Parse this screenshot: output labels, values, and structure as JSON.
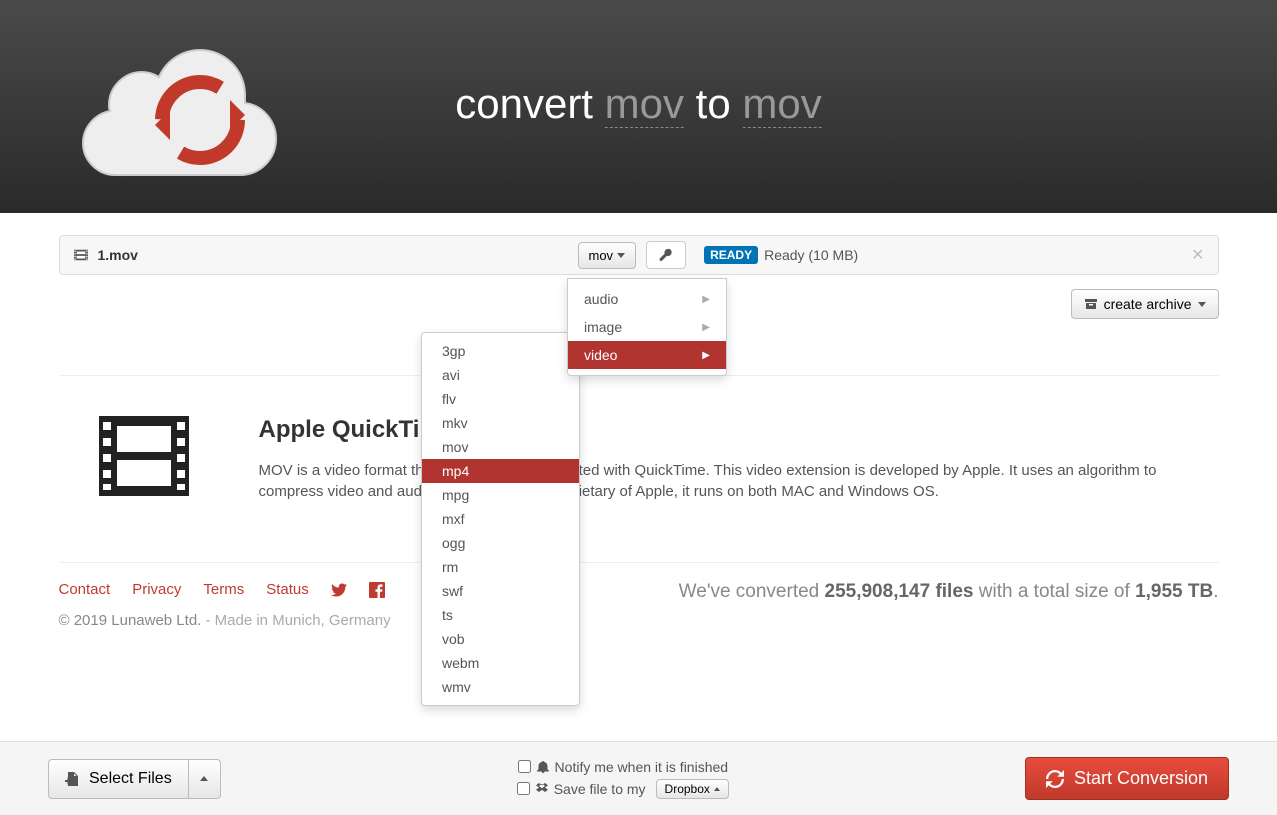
{
  "header": {
    "title_prefix": "convert ",
    "from_fmt": "mov",
    "title_mid": " to ",
    "to_fmt": "mov"
  },
  "file": {
    "name": "1.mov",
    "selected_fmt": "mov",
    "ready_badge": "READY",
    "ready_text": "Ready (10 MB)"
  },
  "archive_btn": "create archive",
  "categories": [
    {
      "label": "audio",
      "active": false
    },
    {
      "label": "image",
      "active": false
    },
    {
      "label": "video",
      "active": true
    }
  ],
  "formats": [
    "3gp",
    "avi",
    "flv",
    "mkv",
    "mov",
    "mp4",
    "mpg",
    "mxf",
    "ogg",
    "rm",
    "swf",
    "ts",
    "vob",
    "webm",
    "wmv"
  ],
  "hover_format": "mp4",
  "description": {
    "title": "Apple QuickTime Movie",
    "body": "MOV is a video format that is commonly associated with QuickTime. This video extension is developed by Apple. It uses an algorithm to compress video and audio. Although it is a proprietary of Apple, it runs on both MAC and Windows OS."
  },
  "footer": {
    "links": [
      "Contact",
      "Privacy",
      "Terms",
      "Status"
    ],
    "copyright": "© 2019 Lunaweb Ltd. ",
    "made_in": "- Made in Munich, Germany",
    "stats_prefix": "We've converted ",
    "files_count": "255,908,147 files",
    "stats_mid": " with a total size of ",
    "total_size": "1,955 TB",
    "stats_suffix": "."
  },
  "bottom": {
    "select_files": "Select Files",
    "notify": "Notify me when it is finished",
    "save_to": "Save file to my",
    "dropbox": "Dropbox",
    "start": "Start Conversion"
  }
}
